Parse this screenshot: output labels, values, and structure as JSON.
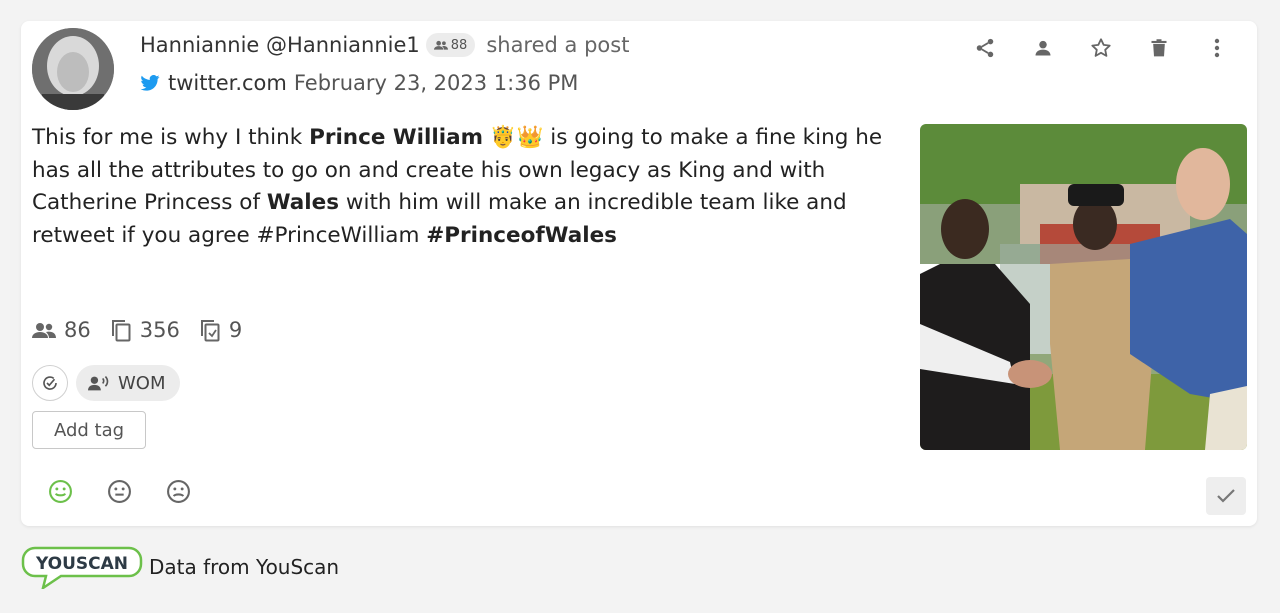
{
  "post": {
    "author_name": "Hanniannie",
    "author_handle": "@Hanniannie1",
    "followers_badge": "88",
    "action": "shared a post",
    "source": "twitter.com",
    "date": "February 23, 2023 1:36 PM",
    "text": {
      "p1": "This for me is why I think ",
      "b1": "Prince William",
      "emoji": " 🤴👑 ",
      "p2": "is going to make a fine king he has all the attributes to go on and create his own legacy as King and with Catherine Princess of ",
      "b2": "Wales",
      "p3": " with him will make an incredible team like and retweet if you agree #PrinceWilliam ",
      "b3": "#PrinceofWales"
    },
    "stats": {
      "audience": "86",
      "engagement": "356",
      "reposts": "9"
    },
    "chip_label": "WOM",
    "add_tag_label": "Add tag"
  },
  "footer": {
    "logo_text": "YOUSCAN",
    "text": "Data from YouScan"
  },
  "colors": {
    "accent_green": "#6cc04a",
    "twitter_blue": "#1d9bf0",
    "icon_gray": "#666666",
    "logo_dark": "#2d3a45"
  },
  "icons": [
    "share-icon",
    "person-icon",
    "star-icon",
    "trash-icon",
    "more-vert-icon",
    "twitter-icon",
    "people-icon",
    "copy-icon",
    "repost-icon",
    "check-circle-icon",
    "wom-icon",
    "smile-icon",
    "neutral-icon",
    "sad-icon",
    "check-icon"
  ]
}
